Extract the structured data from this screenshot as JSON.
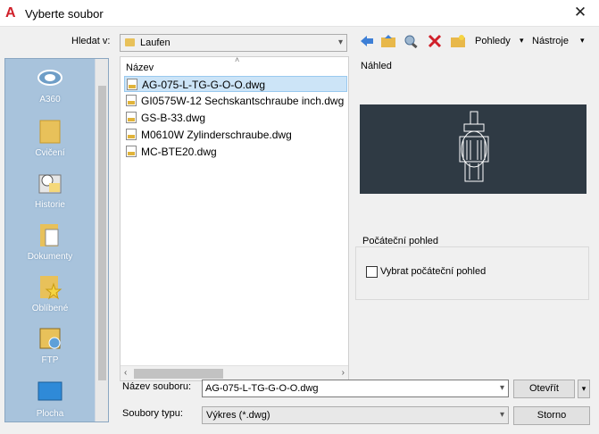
{
  "window": {
    "title": "Vyberte soubor",
    "close": "✕"
  },
  "lookin": {
    "label": "Hledat v:",
    "value": "Laufen"
  },
  "toolbar": {
    "views_label": "Pohledy",
    "tools_label": "Nástroje"
  },
  "places": [
    {
      "label": "A360",
      "icon": "a360-icon"
    },
    {
      "label": "Cvičení",
      "icon": "folder-icon"
    },
    {
      "label": "Historie",
      "icon": "history-icon"
    },
    {
      "label": "Dokumenty",
      "icon": "documents-icon"
    },
    {
      "label": "Oblíbené",
      "icon": "favorites-icon"
    },
    {
      "label": "FTP",
      "icon": "ftp-icon"
    },
    {
      "label": "Plocha",
      "icon": "desktop-icon"
    }
  ],
  "file_list": {
    "column_header": "Název",
    "files": [
      {
        "name": "AG-075-L-TG-G-O-O.dwg",
        "selected": true
      },
      {
        "name": "GI0575W-12 Sechskantschraube inch.dwg",
        "selected": false
      },
      {
        "name": "GS-B-33.dwg",
        "selected": false
      },
      {
        "name": "M0610W Zylinderschraube.dwg",
        "selected": false
      },
      {
        "name": "MC-BTE20.dwg",
        "selected": false
      }
    ]
  },
  "preview": {
    "label": "Náhled"
  },
  "initial_view": {
    "group_title": "Počáteční pohled",
    "checkbox_label": "Vybrat počáteční pohled",
    "checked": false
  },
  "filename": {
    "label": "Název souboru:",
    "value": "AG-075-L-TG-G-O-O.dwg"
  },
  "filetype": {
    "label": "Soubory typu:",
    "value": "Výkres (*.dwg)"
  },
  "buttons": {
    "open": "Otevřít",
    "cancel": "Storno"
  },
  "colors": {
    "accent_red": "#d0202a",
    "places_bg": "#a8c3dc",
    "preview_bg": "#2f3a44",
    "selection": "#cce4f7"
  }
}
